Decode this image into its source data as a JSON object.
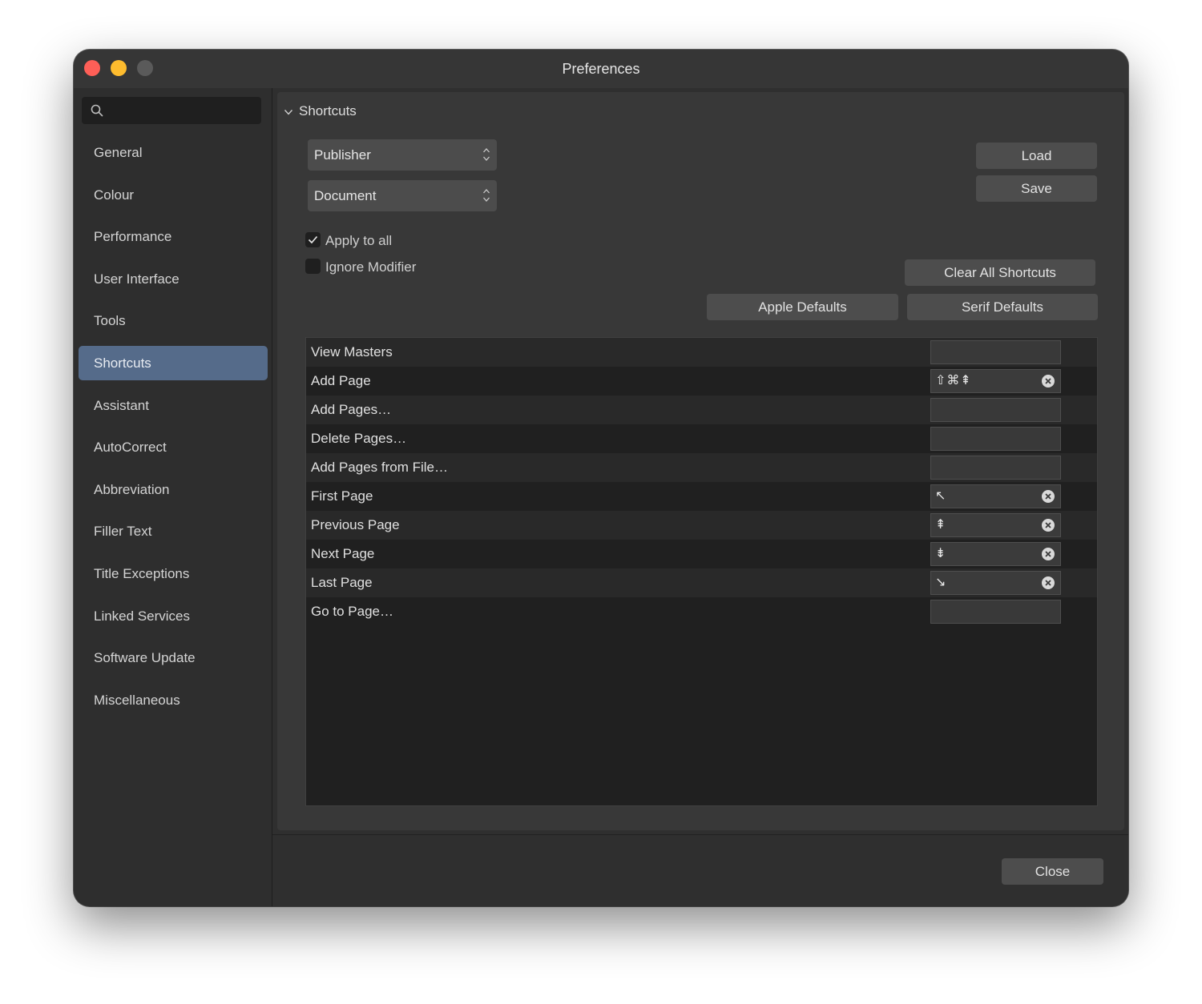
{
  "window": {
    "title": "Preferences"
  },
  "search": {
    "placeholder": ""
  },
  "sidebar": {
    "items": [
      {
        "label": "General",
        "active": false
      },
      {
        "label": "Colour",
        "active": false
      },
      {
        "label": "Performance",
        "active": false
      },
      {
        "label": "User Interface",
        "active": false
      },
      {
        "label": "Tools",
        "active": false
      },
      {
        "label": "Shortcuts",
        "active": true
      },
      {
        "label": "Assistant",
        "active": false
      },
      {
        "label": "AutoCorrect",
        "active": false
      },
      {
        "label": "Abbreviation",
        "active": false
      },
      {
        "label": "Filler Text",
        "active": false
      },
      {
        "label": "Title Exceptions",
        "active": false
      },
      {
        "label": "Linked Services",
        "active": false
      },
      {
        "label": "Software Update",
        "active": false
      },
      {
        "label": "Miscellaneous",
        "active": false
      }
    ]
  },
  "shortcuts": {
    "section_title": "Shortcuts",
    "app_select": "Publisher",
    "context_select": "Document",
    "load_label": "Load",
    "save_label": "Save",
    "apply_to_all": {
      "label": "Apply to all",
      "checked": true
    },
    "ignore_modifier": {
      "label": "Ignore Modifier",
      "checked": false
    },
    "clear_all_label": "Clear All Shortcuts",
    "apple_defaults_label": "Apple Defaults",
    "serif_defaults_label": "Serif Defaults",
    "rows": [
      {
        "label": "View Masters",
        "key": ""
      },
      {
        "label": "Add Page",
        "key": "⇧⌘⇞"
      },
      {
        "label": "Add Pages…",
        "key": ""
      },
      {
        "label": "Delete Pages…",
        "key": ""
      },
      {
        "label": "Add Pages from File…",
        "key": ""
      },
      {
        "label": "First Page",
        "key": "↖"
      },
      {
        "label": "Previous Page",
        "key": "⇞"
      },
      {
        "label": "Next Page",
        "key": "⇟"
      },
      {
        "label": "Last Page",
        "key": "↘"
      },
      {
        "label": "Go to Page…",
        "key": ""
      }
    ]
  },
  "footer": {
    "close_label": "Close"
  },
  "colors": {
    "accent": "#556b8a",
    "close": "#fe5f57",
    "minimize": "#febc2e",
    "zoom": "#5a5a5a"
  }
}
